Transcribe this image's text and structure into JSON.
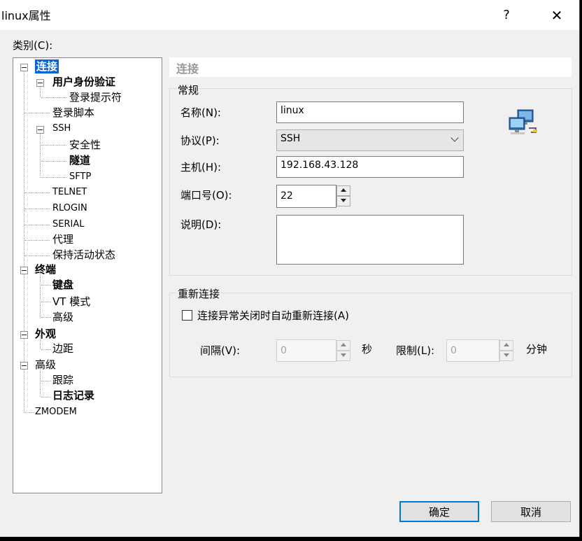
{
  "window": {
    "title": "linux属性",
    "help": "?",
    "close": "✕"
  },
  "category_label": "类别(C):",
  "tree": [
    {
      "label": "连接",
      "bold": true,
      "selected": true
    },
    {
      "label": "用户身份验证",
      "bold": true
    },
    {
      "label": "登录提示符"
    },
    {
      "label": "登录脚本"
    },
    {
      "label": "SSH"
    },
    {
      "label": "安全性"
    },
    {
      "label": "隧道",
      "bold": true
    },
    {
      "label": "SFTP"
    },
    {
      "label": "TELNET"
    },
    {
      "label": "RLOGIN"
    },
    {
      "label": "SERIAL"
    },
    {
      "label": "代理"
    },
    {
      "label": "保持活动状态"
    },
    {
      "label": "终端",
      "bold": true
    },
    {
      "label": "键盘",
      "bold": true
    },
    {
      "label": "VT 模式"
    },
    {
      "label": "高级"
    },
    {
      "label": "外观",
      "bold": true
    },
    {
      "label": "边距"
    },
    {
      "label": "高级"
    },
    {
      "label": "跟踪"
    },
    {
      "label": "日志记录",
      "bold": true
    },
    {
      "label": "ZMODEM"
    }
  ],
  "panel": {
    "header": "连接",
    "general": {
      "title": "常规",
      "name_label": "名称(N):",
      "name_value": "linux",
      "protocol_label": "协议(P):",
      "protocol_value": "SSH",
      "host_label": "主机(H):",
      "host_value": "192.168.43.128",
      "port_label": "端口号(O):",
      "port_value": "22",
      "desc_label": "说明(D):",
      "desc_value": "",
      "icon": "network-computers-icon"
    },
    "reconnect": {
      "title": "重新连接",
      "checkbox_label": "连接异常关闭时自动重新连接(A)",
      "checked": false,
      "interval_label": "间隔(V):",
      "interval_value": "0",
      "interval_unit": "秒",
      "limit_label": "限制(L):",
      "limit_value": "0",
      "limit_unit": "分钟"
    }
  },
  "buttons": {
    "ok": "确定",
    "cancel": "取消"
  }
}
